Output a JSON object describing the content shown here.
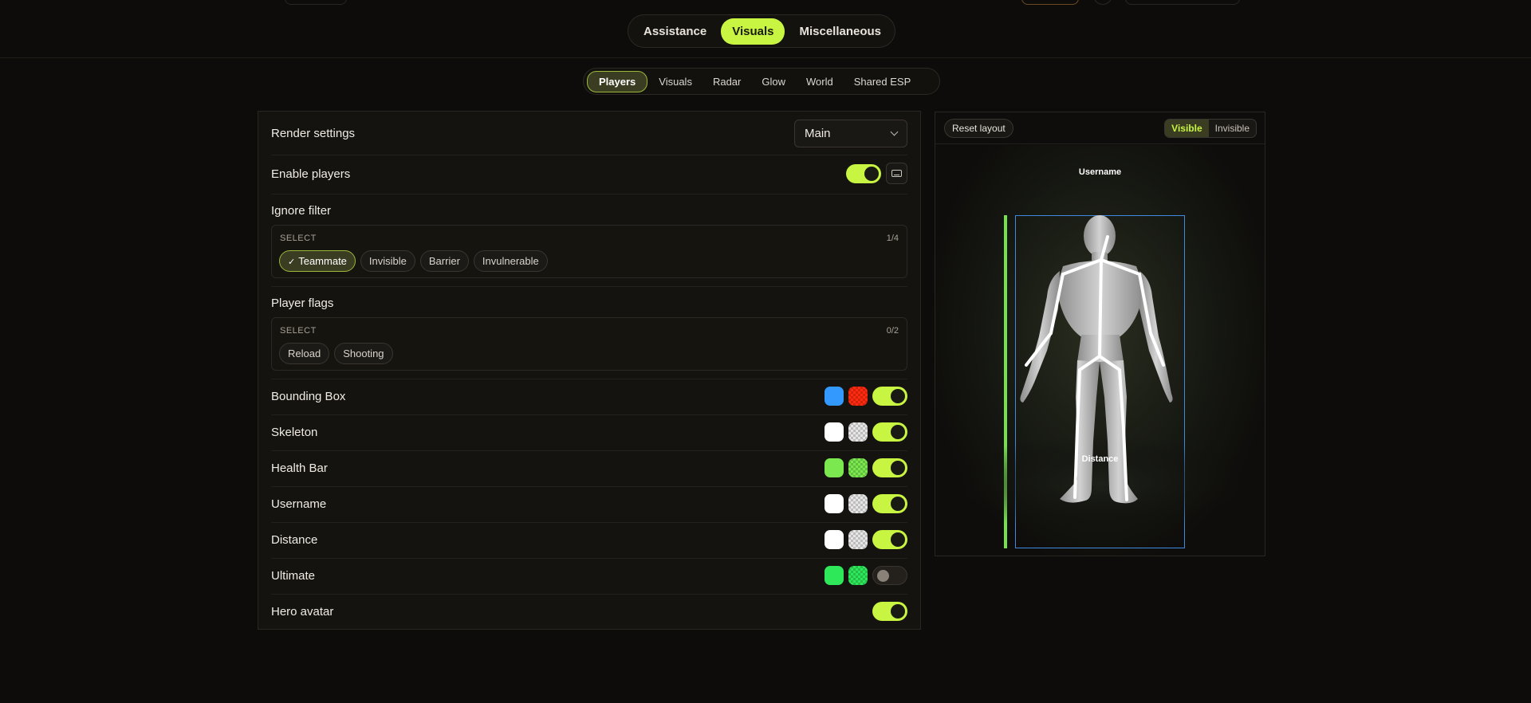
{
  "main_tabs": [
    {
      "label": "Assistance",
      "active": false
    },
    {
      "label": "Visuals",
      "active": true
    },
    {
      "label": "Miscellaneous",
      "active": false
    }
  ],
  "sub_tabs": [
    {
      "label": "Players",
      "active": true
    },
    {
      "label": "Visuals",
      "active": false
    },
    {
      "label": "Radar",
      "active": false
    },
    {
      "label": "Glow",
      "active": false
    },
    {
      "label": "World",
      "active": false
    },
    {
      "label": "Shared ESP",
      "active": false
    }
  ],
  "settings": {
    "render_label": "Render settings",
    "render_value": "Main",
    "enable_players_label": "Enable players",
    "enable_players_on": true,
    "ignore_filter": {
      "title": "Ignore filter",
      "select_label": "SELECT",
      "count": "1/4",
      "chips": [
        {
          "label": "Teammate",
          "selected": true
        },
        {
          "label": "Invisible",
          "selected": false
        },
        {
          "label": "Barrier",
          "selected": false
        },
        {
          "label": "Invulnerable",
          "selected": false
        }
      ]
    },
    "player_flags": {
      "title": "Player flags",
      "select_label": "SELECT",
      "count": "0/2",
      "chips": [
        {
          "label": "Reload",
          "selected": false
        },
        {
          "label": "Shooting",
          "selected": false
        }
      ]
    },
    "features": [
      {
        "label": "Bounding Box",
        "color1": "#3399ff",
        "color2": "#ff2a0f",
        "on": true
      },
      {
        "label": "Skeleton",
        "color1": "#ffffff",
        "color2": "#e6e6e6",
        "on": true
      },
      {
        "label": "Health Bar",
        "color1": "#7ae84e",
        "color2": "#7ae84e",
        "on": true
      },
      {
        "label": "Username",
        "color1": "#ffffff",
        "color2": "#e6e6e6",
        "on": true
      },
      {
        "label": "Distance",
        "color1": "#ffffff",
        "color2": "#e6e6e6",
        "on": true
      },
      {
        "label": "Ultimate",
        "color1": "#2ee85a",
        "color2": "#2ee85a",
        "on": false
      },
      {
        "label": "Hero avatar",
        "on": true
      }
    ]
  },
  "preview": {
    "reset_label": "Reset layout",
    "visible_label": "Visible",
    "invisible_label": "Invisible",
    "esp_username": "Username",
    "esp_distance": "Distance",
    "box_color": "#3d8ae0",
    "health_color": "#74e24a"
  }
}
